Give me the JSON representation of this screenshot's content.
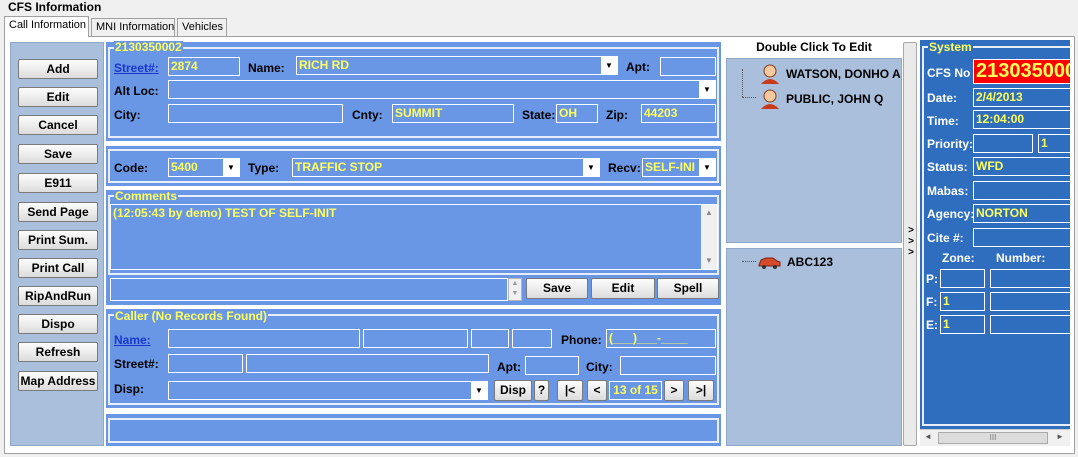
{
  "window": {
    "title": "CFS Information"
  },
  "tabs": [
    {
      "label": "Call Information",
      "active": true
    },
    {
      "label": "MNI Information",
      "active": false
    },
    {
      "label": "Vehicles",
      "active": false
    }
  ],
  "actions": {
    "add": "Add",
    "edit": "Edit",
    "cancel": "Cancel",
    "save": "Save",
    "e911": "E911",
    "send_page": "Send Page",
    "print_sum": "Print Sum.",
    "print_call": "Print Call",
    "rip_and_run": "RipAndRun",
    "dispo": "Dispo",
    "refresh": "Refresh",
    "map_address": "Map Address"
  },
  "location": {
    "legend": "2130350002",
    "street_no_label": "Street#:",
    "street_no": "2874",
    "name_label": "Name:",
    "name": "RICH RD",
    "apt_label": "Apt:",
    "apt": "",
    "alt_loc_label": "Alt Loc:",
    "alt_loc": "",
    "city_label": "City:",
    "city": "",
    "cnty_label": "Cnty:",
    "cnty": "SUMMIT",
    "state_label": "State:",
    "state": "OH",
    "zip_label": "Zip:",
    "zip": "44203"
  },
  "call_type": {
    "code_label": "Code:",
    "code": "5400",
    "type_label": "Type:",
    "type": "TRAFFIC STOP",
    "recv_label": "Recv:",
    "recv": "SELF-INI"
  },
  "comments": {
    "legend": "Comments",
    "text": "(12:05:43 by demo) TEST OF SELF-INIT",
    "save": "Save",
    "edit": "Edit",
    "spell": "Spell"
  },
  "caller": {
    "legend": "Caller (No Records Found)",
    "name_label": "Name:",
    "phone_label": "Phone:",
    "phone": "(___)___-____",
    "street_label": "Street#:",
    "apt_label": "Apt:",
    "city_label": "City:",
    "disp_label": "Disp:",
    "disp_button": "Disp",
    "help_button": "?",
    "first": "|<",
    "prev": "<",
    "record": "13 of 15",
    "next": ">",
    "last": ">|"
  },
  "persons": {
    "header": "Double Click To Edit",
    "items": [
      "WATSON, DONHO A",
      "PUBLIC, JOHN Q"
    ]
  },
  "vehicles": {
    "items": [
      "ABC123"
    ]
  },
  "splitter": {
    "arrows": "> > >"
  },
  "system": {
    "legend": "System",
    "cfs_label": "CFS No",
    "cfs_no": "213035000",
    "date_label": "Date:",
    "date": "2/4/2013",
    "time_label": "Time:",
    "time": "12:04:00",
    "priority_label": "Priority:",
    "priority": "",
    "priority2": "1",
    "status_label": "Status:",
    "status": "WFD",
    "mabas_label": "Mabas:",
    "mabas": "",
    "agency_label": "Agency:",
    "agency": "NORTON",
    "cite_label": "Cite #:",
    "cite": "",
    "zone_label": "Zone:",
    "number_label": "Number:",
    "p_label": "P:",
    "p_zone": "",
    "p_number": "",
    "f_label": "F:",
    "f_zone": "1",
    "f_number": "",
    "e_label": "E:",
    "e_zone": "1",
    "e_number": ""
  },
  "scrollbar": {
    "grip": "III"
  },
  "colors": {
    "field_blue": "#6a96e6",
    "panel_blue": "#2f6ebf",
    "field_text": "#ffff5a",
    "cfs_red": "#ff0000"
  }
}
